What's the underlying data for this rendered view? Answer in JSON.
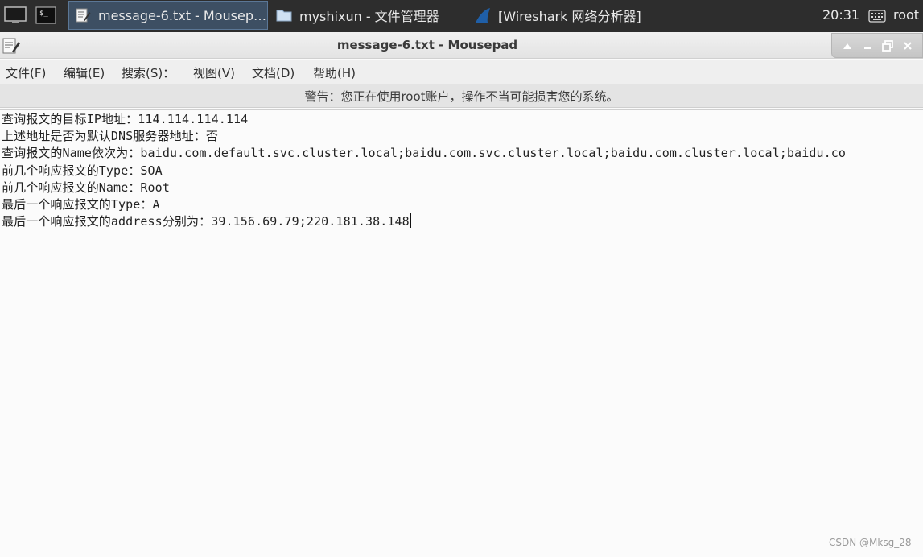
{
  "taskbar": {
    "tasks": [
      {
        "label": "message-6.txt - Mousep…",
        "icon": "text-editor-icon"
      },
      {
        "label": "myshixun - 文件管理器",
        "icon": "folder-icon"
      },
      {
        "label": "[Wireshark 网络分析器]",
        "icon": "wireshark-fin-icon"
      }
    ],
    "clock": "20:31",
    "user": "root"
  },
  "window": {
    "title": "message-6.txt - Mousepad"
  },
  "menu": [
    "文件(F)",
    "编辑(E)",
    "搜索(S)：",
    "视图(V)",
    "文档(D)",
    "帮助(H)"
  ],
  "warning": "警告：您正在使用root账户，操作不当可能损害您的系统。",
  "editor": {
    "lines": [
      "查询报文的目标IP地址：114.114.114.114",
      "上述地址是否为默认DNS服务器地址：否",
      "查询报文的Name依次为：baidu.com.default.svc.cluster.local;baidu.com.svc.cluster.local;baidu.com.cluster.local;baidu.co",
      "前几个响应报文的Type：SOA",
      "前几个响应报文的Name：Root",
      "最后一个响应报文的Type：A",
      "最后一个响应报文的address分别为：39.156.69.79;220.181.38.148"
    ]
  },
  "watermark": "CSDN @Mksg_28",
  "colors": {
    "taskbar_bg": "#2d2d2d",
    "active_task": "#3d4f63",
    "wireshark_blue": "#1f5fa8",
    "editor_bg": "#fbfbfb"
  }
}
